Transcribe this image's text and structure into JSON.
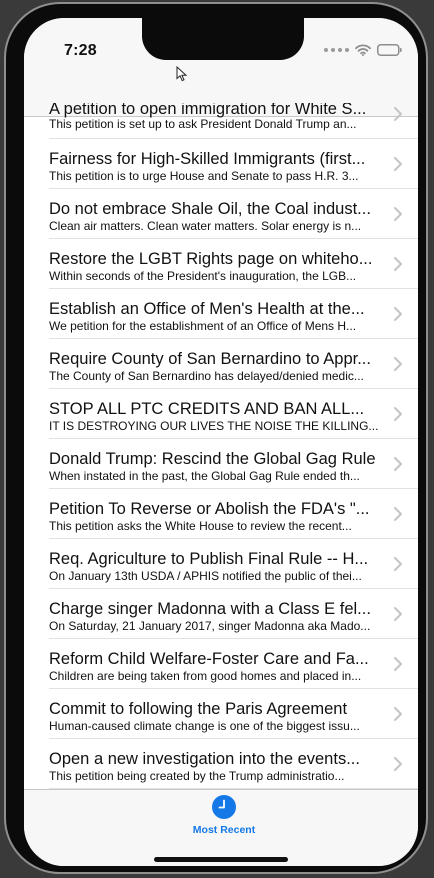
{
  "status": {
    "time": "7:28"
  },
  "petitions": [
    {
      "title": "A petition to open immigration for White S...",
      "subtitle": "This petition is set up to ask President Donald Trump an..."
    },
    {
      "title": "Fairness for High-Skilled Immigrants (first...",
      "subtitle": "This petition is to urge House and Senate to pass H.R. 3..."
    },
    {
      "title": "Do not embrace Shale Oil, the Coal indust...",
      "subtitle": "Clean air matters. Clean water matters. Solar energy is n..."
    },
    {
      "title": "Restore the LGBT Rights page on whiteho...",
      "subtitle": "Within seconds of the President's inauguration, the LGB..."
    },
    {
      "title": "Establish an Office of Men's Health at the...",
      "subtitle": "We petition for the establishment of an Office of Mens H..."
    },
    {
      "title": "Require County of San Bernardino to Appr...",
      "subtitle": "The County of San Bernardino has delayed/denied medic..."
    },
    {
      "title": "STOP ALL PTC CREDITS AND BAN ALL...",
      "subtitle": "IT IS DESTROYING OUR LIVES THE NOISE THE KILLING..."
    },
    {
      "title": "Donald Trump: Rescind the Global Gag Rule",
      "subtitle": "When instated in the past, the Global Gag Rule ended th..."
    },
    {
      "title": "Petition To Reverse or Abolish the FDA's \"...",
      "subtitle": "This petition asks the White House to review the recent..."
    },
    {
      "title": "Req. Agriculture to Publish Final Rule -- H...",
      "subtitle": "On January 13th USDA / APHIS notified the public of thei..."
    },
    {
      "title": "Charge singer Madonna with a Class E fel...",
      "subtitle": "On Saturday, 21 January 2017, singer Madonna aka Mado..."
    },
    {
      "title": "Reform Child Welfare-Foster Care and Fa...",
      "subtitle": "Children are being taken from good homes and placed in..."
    },
    {
      "title": "Commit to following the Paris Agreement",
      "subtitle": "Human-caused climate change is one of the biggest issu..."
    },
    {
      "title": "Open a new investigation into the events...",
      "subtitle": "This petition being created by the Trump administratio..."
    }
  ],
  "tab_bar": {
    "most_recent_label": "Most Recent"
  },
  "colors": {
    "accent": "#1479e6",
    "bar_background": "#f7f7f7",
    "separator": "#c8c7cc"
  }
}
